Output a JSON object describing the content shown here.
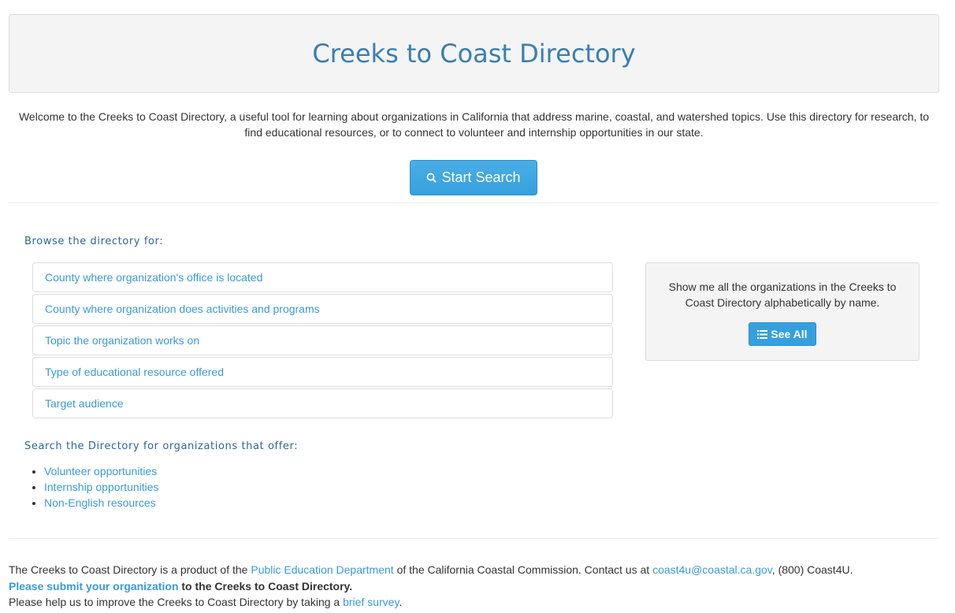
{
  "header": {
    "title": "Creeks to Coast Directory"
  },
  "welcome": "Welcome to the Creeks to Coast Directory, a useful tool for learning about organizations in California that address marine, coastal, and watershed topics. Use this directory for research, to find educational resources, or to connect to volunteer and internship opportunities in our state.",
  "start_search": "Start Search",
  "browse": {
    "heading": "Browse the directory for:",
    "items": [
      "County where organization's office is located",
      "County where organization does activities and programs",
      "Topic the organization works on",
      "Type of educational resource offered",
      "Target audience"
    ]
  },
  "panel": {
    "text": "Show me all the organizations in the Creeks to Coast Directory alphabetically by name.",
    "button": "See All"
  },
  "search": {
    "heading": "Search the Directory for organizations that offer:",
    "items": [
      "Volunteer opportunities",
      "Internship opportunities",
      "Non-English resources"
    ]
  },
  "footer": {
    "l1a": "The Creeks to Coast Directory is a product of the ",
    "l1link": "Public Education Department",
    "l1b": " of the California Coastal Commission. Contact us at ",
    "l1email": "coast4u@coastal.ca.gov",
    "l1c": ", (800) Coast4U.",
    "l2link": "Please submit your organization",
    "l2b": " to the Creeks to Coast Directory.",
    "l3a": "Please help us to improve the Creeks to Coast Directory by taking a ",
    "l3link": "brief survey",
    "l3b": "."
  }
}
